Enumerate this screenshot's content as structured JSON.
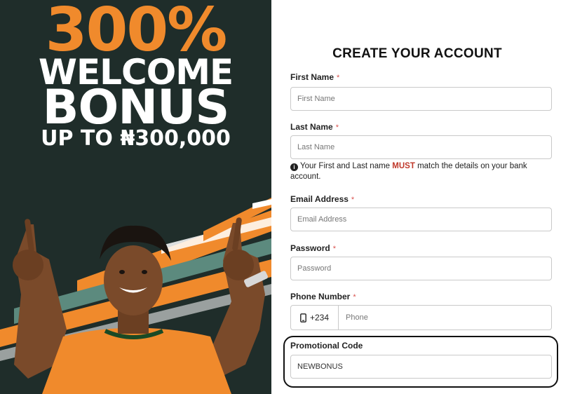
{
  "banner": {
    "percent": "300%",
    "welcome": "WELCOME",
    "bonus": "BONUS",
    "up_to": "UP TO ₦300,000"
  },
  "form": {
    "title": "CREATE YOUR ACCOUNT",
    "first_name": {
      "label": "First Name",
      "required": "*",
      "placeholder": "First Name",
      "value": ""
    },
    "last_name": {
      "label": "Last Name",
      "required": "*",
      "placeholder": "Last Name",
      "value": ""
    },
    "note": {
      "before": "Your First and Last name",
      "emphasis": "MUST",
      "after": "match the details on your bank account."
    },
    "email": {
      "label": "Email Address",
      "required": "*",
      "placeholder": "Email Address",
      "value": ""
    },
    "password": {
      "label": "Password",
      "required": "*",
      "placeholder": "Password",
      "value": ""
    },
    "phone": {
      "label": "Phone Number",
      "required": "*",
      "country_code": "+234",
      "placeholder": "Phone",
      "value": ""
    },
    "promo": {
      "label": "Promotional Code",
      "value": "NEWBONUS"
    }
  },
  "colors": {
    "banner_bg": "#1f2d2a",
    "accent_orange": "#f08a2c",
    "teal": "#5c8a7e",
    "required": "#d9534f",
    "must": "#c0392b"
  }
}
